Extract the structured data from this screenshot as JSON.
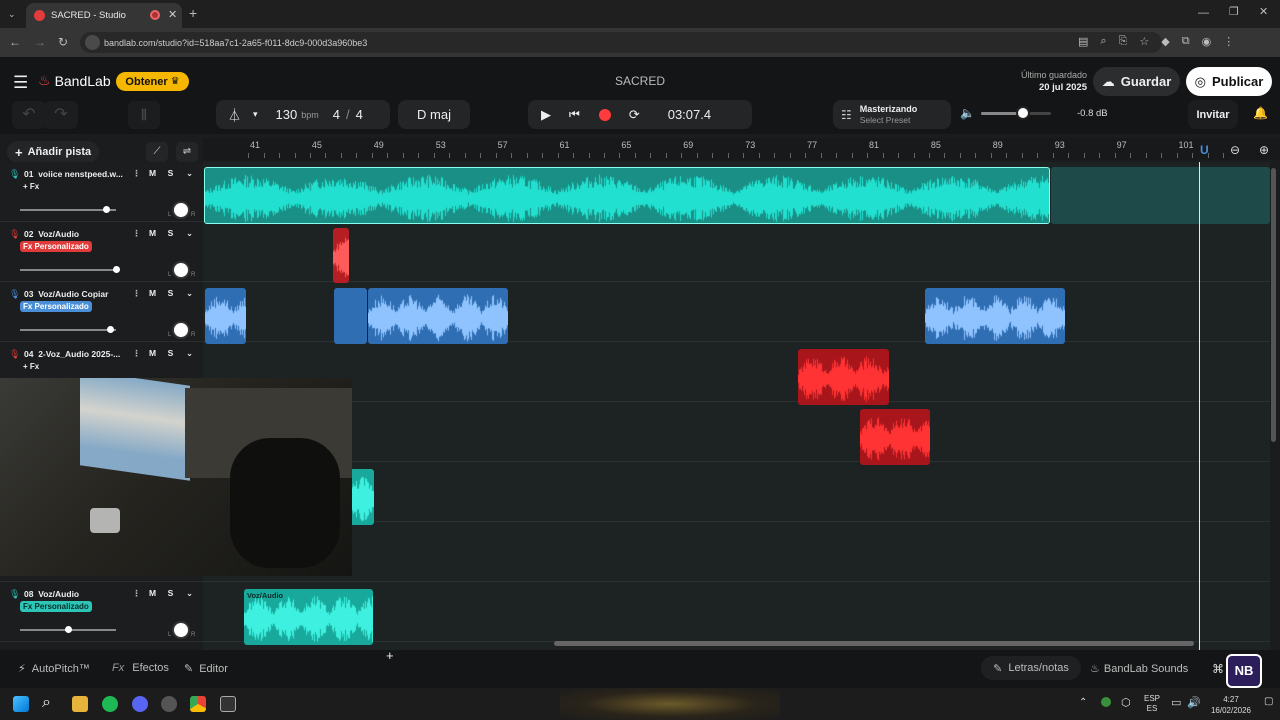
{
  "browser": {
    "tab_title": "SACRED - Studio",
    "url": "bandlab.com/studio?id=518aa7c1-2a65-f011-8dc9-000d3a960be3"
  },
  "header": {
    "brand": "BandLab",
    "obtener_label": "Obtener",
    "project_title": "SACRED",
    "last_saved_label": "Último guardado",
    "last_saved_date": "20 jul 2025",
    "save_label": "Guardar",
    "publish_label": "Publicar"
  },
  "toolbar": {
    "tempo": "130",
    "tempo_unit": "bpm",
    "time_sig_num": "4",
    "time_sig_sep": "/",
    "time_sig_den": "4",
    "key": "D maj",
    "time": "03:07.4",
    "mastering_title": "Masterizando",
    "mastering_preset": "Select Preset",
    "volume_db": "-0.8 dB",
    "volume_level": 0.6,
    "invite_label": "Invitar"
  },
  "sidebar": {
    "add_track_label": "Añadir pista"
  },
  "ruler": [
    "41",
    "45",
    "49",
    "53",
    "57",
    "61",
    "65",
    "69",
    "73",
    "77",
    "81",
    "85",
    "89",
    "93",
    "97",
    "101"
  ],
  "tracks": [
    {
      "num": "01",
      "name": "voiice nenstpeed.w...",
      "fx": "+ Fx",
      "fx_type": "plain",
      "mic_color": "#2ec4b6",
      "vol": 0.9
    },
    {
      "num": "02",
      "name": "Voz/Audio",
      "fx": "Fx Personalizado",
      "fx_type": "red",
      "mic_color": "#e03b3b",
      "vol": 1.0
    },
    {
      "num": "03",
      "name": "Voz/Audio Copiar",
      "fx": "Fx Personalizado",
      "fx_type": "blue",
      "mic_color": "#4a8ed8",
      "vol": 0.94
    },
    {
      "num": "04",
      "name": "2-Voz_Audio 2025-...",
      "fx": "+ Fx",
      "fx_type": "plain",
      "mic_color": "#e03b3b",
      "vol": 0.9
    },
    {
      "num": "08",
      "name": "Voz/Audio",
      "fx": "Fx Personalizado",
      "fx_type": "teal",
      "mic_color": "#2ec4b6",
      "vol": 0.5
    }
  ],
  "mute_label": "M",
  "solo_label": "S",
  "clips": {
    "voz_audio_label": "Voz/Audio"
  },
  "bottom": {
    "autopitch": "AutoPitch™",
    "effects_prefix": "Fx",
    "effects": "Efectos",
    "editor": "Editor",
    "lyrics": "Letras/notas",
    "sounds": "BandLab Sounds"
  },
  "taskbar": {
    "lang_top": "ESP",
    "lang_bottom": "ES",
    "time": "4:27",
    "date": "16/02/2026"
  },
  "colors": {
    "teal": "#2ec4b6",
    "clip_teal": "#22d3c3",
    "clip_blue": "#3a7cc4",
    "clip_red": "#d9252a",
    "accent_yellow": "#f5b700",
    "record_red": "#ff3b3b"
  }
}
